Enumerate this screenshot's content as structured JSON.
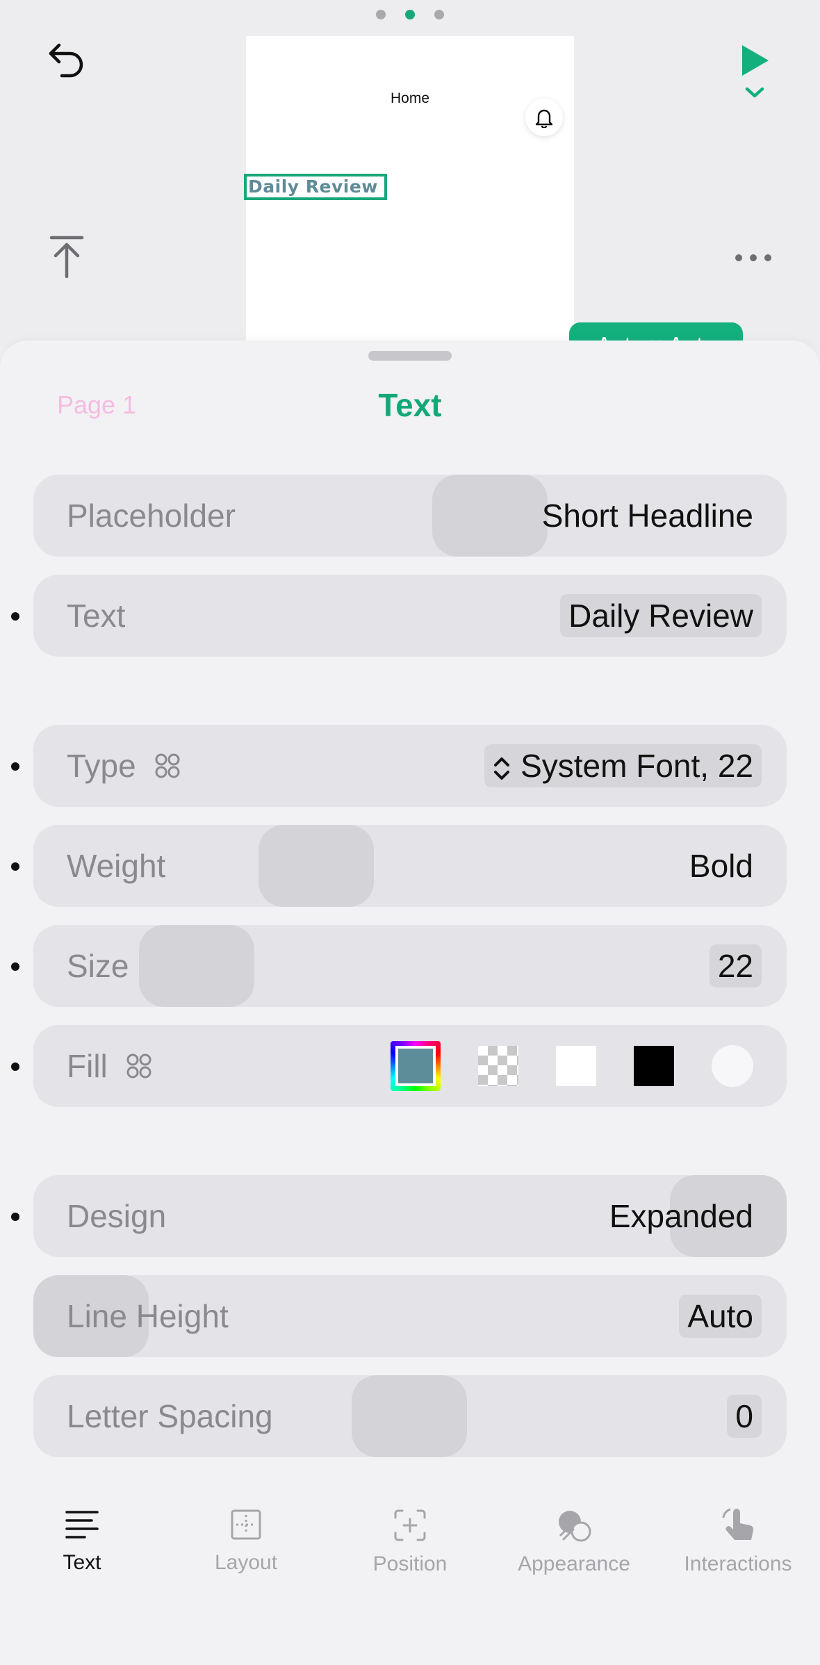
{
  "canvas": {
    "page_dots": 3,
    "active_page_dot": 1,
    "preview": {
      "title": "Home",
      "selected_text": "Daily Review",
      "size_badge": "Auto × Auto"
    }
  },
  "sheet": {
    "breadcrumb": "Page 1",
    "title": "Text",
    "rows": {
      "placeholder": {
        "label": "Placeholder",
        "value": "Short Headline"
      },
      "text": {
        "label": "Text",
        "value": "Daily Review"
      },
      "type": {
        "label": "Type",
        "value": "System Font, 22"
      },
      "weight": {
        "label": "Weight",
        "value": "Bold"
      },
      "size": {
        "label": "Size",
        "value": "22"
      },
      "fill": {
        "label": "Fill",
        "selected_color": "#5e8d9a",
        "swatches": [
          "custom-color",
          "transparent",
          "white",
          "black",
          "clear-circle"
        ]
      },
      "design": {
        "label": "Design",
        "value": "Expanded"
      },
      "line_height": {
        "label": "Line Height",
        "value": "Auto"
      },
      "letter_spacing": {
        "label": "Letter Spacing",
        "value": "0"
      }
    }
  },
  "tabs": [
    {
      "label": "Text",
      "icon": "text-lines-icon",
      "active": true
    },
    {
      "label": "Layout",
      "icon": "layout-icon",
      "active": false
    },
    {
      "label": "Position",
      "icon": "position-icon",
      "active": false
    },
    {
      "label": "Appearance",
      "icon": "appearance-icon",
      "active": false
    },
    {
      "label": "Interactions",
      "icon": "tap-hand-icon",
      "active": false
    }
  ],
  "colors": {
    "accent": "#14a877",
    "row_bg": "#e4e4e8",
    "label": "#8a8a8e"
  }
}
